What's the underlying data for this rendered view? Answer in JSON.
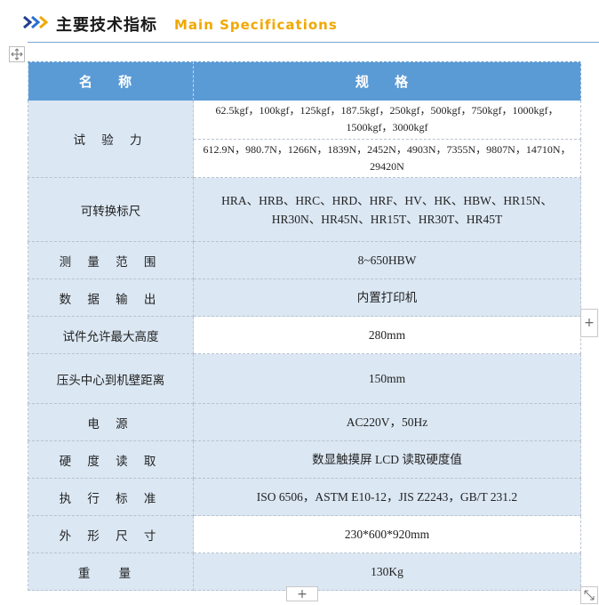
{
  "header": {
    "title_cn": "主要技术指标",
    "title_en": "Main Specifications",
    "chevron_colors": [
      "#1f3f8f",
      "#2b6fd1",
      "#f0a800"
    ]
  },
  "table": {
    "columns": [
      "名 称",
      "规 格"
    ],
    "rows": [
      {
        "label": "试 验 力",
        "values": [
          "62.5kgf，100kgf，125kgf，187.5kgf，250kgf，500kgf，750kgf，1000kgf，1500kgf，3000kgf",
          "612.9N，980.7N，1266N，1839N，2452N，4903N，7355N，9807N，14710N，29420N"
        ]
      },
      {
        "label": "可转换标尺",
        "value": "HRA、HRB、HRC、HRD、HRF、HV、HK、HBW、HR15N、HR30N、HR45N、HR15T、HR30T、HR45T"
      },
      {
        "label": "测 量 范 围",
        "value": "8~650HBW"
      },
      {
        "label": "数 据 输 出",
        "value": "内置打印机"
      },
      {
        "label": "试件允许最大高度",
        "value": "280mm"
      },
      {
        "label": "压头中心到机壁距离",
        "value": "150mm"
      },
      {
        "label": "电 源",
        "value": "AC220V，50Hz"
      },
      {
        "label": "硬 度 读 取",
        "value": "数显触摸屏 LCD 读取硬度值"
      },
      {
        "label": "执 行 标 准",
        "value": "ISO 6506，ASTM E10-12，JIS Z2243，GB/T 231.2"
      },
      {
        "label": "外 形 尺 寸",
        "value": "230*600*920mm"
      },
      {
        "label": "重 量",
        "value": "130Kg"
      }
    ]
  },
  "controls": {
    "add_symbol": "+"
  },
  "colors": {
    "header_bg": "#5b9bd5",
    "label_bg": "#dbe7f3",
    "accent": "#f0a800"
  }
}
